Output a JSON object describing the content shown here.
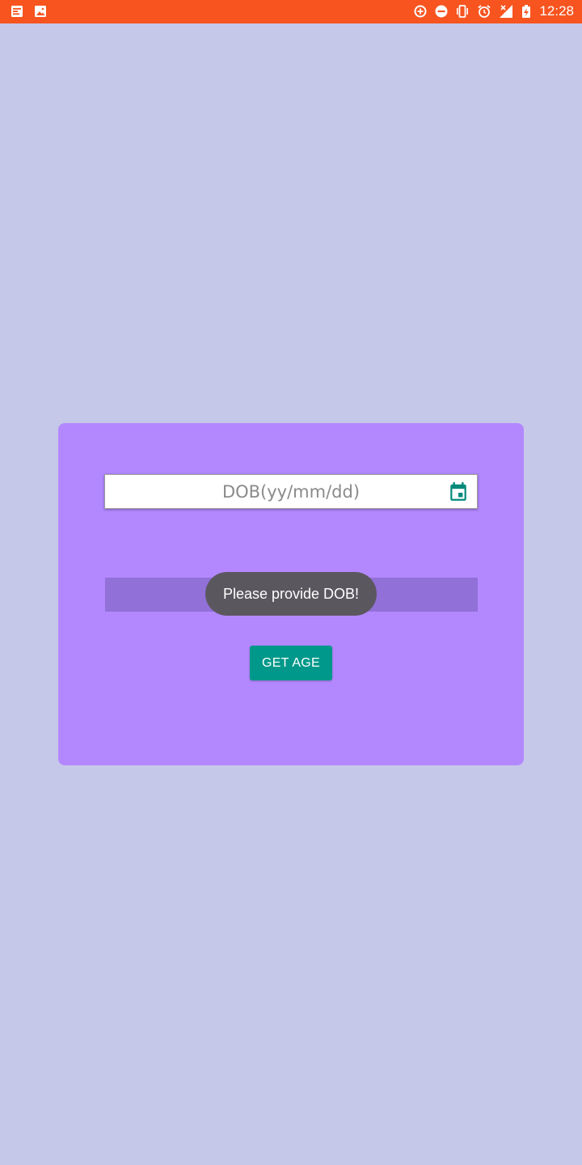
{
  "status_bar": {
    "time": "12:28",
    "color": "#f7541f",
    "left_icons": [
      "notification-news-icon",
      "image-icon"
    ],
    "right_icons": [
      "data-saver-icon",
      "do-not-disturb-icon",
      "vibrate-icon",
      "alarm-icon",
      "no-signal-icon",
      "battery-charging-icon"
    ]
  },
  "screen": {
    "background": "#c5c8e8",
    "card_color": "#b388ff",
    "dob_field": {
      "placeholder": "DOB(yy/mm/dd)",
      "value": "",
      "icon": "calendar-icon"
    },
    "get_age_button": {
      "label": "GET AGE",
      "color": "#00988a"
    },
    "toast": {
      "message": "Please provide DOB!"
    }
  }
}
